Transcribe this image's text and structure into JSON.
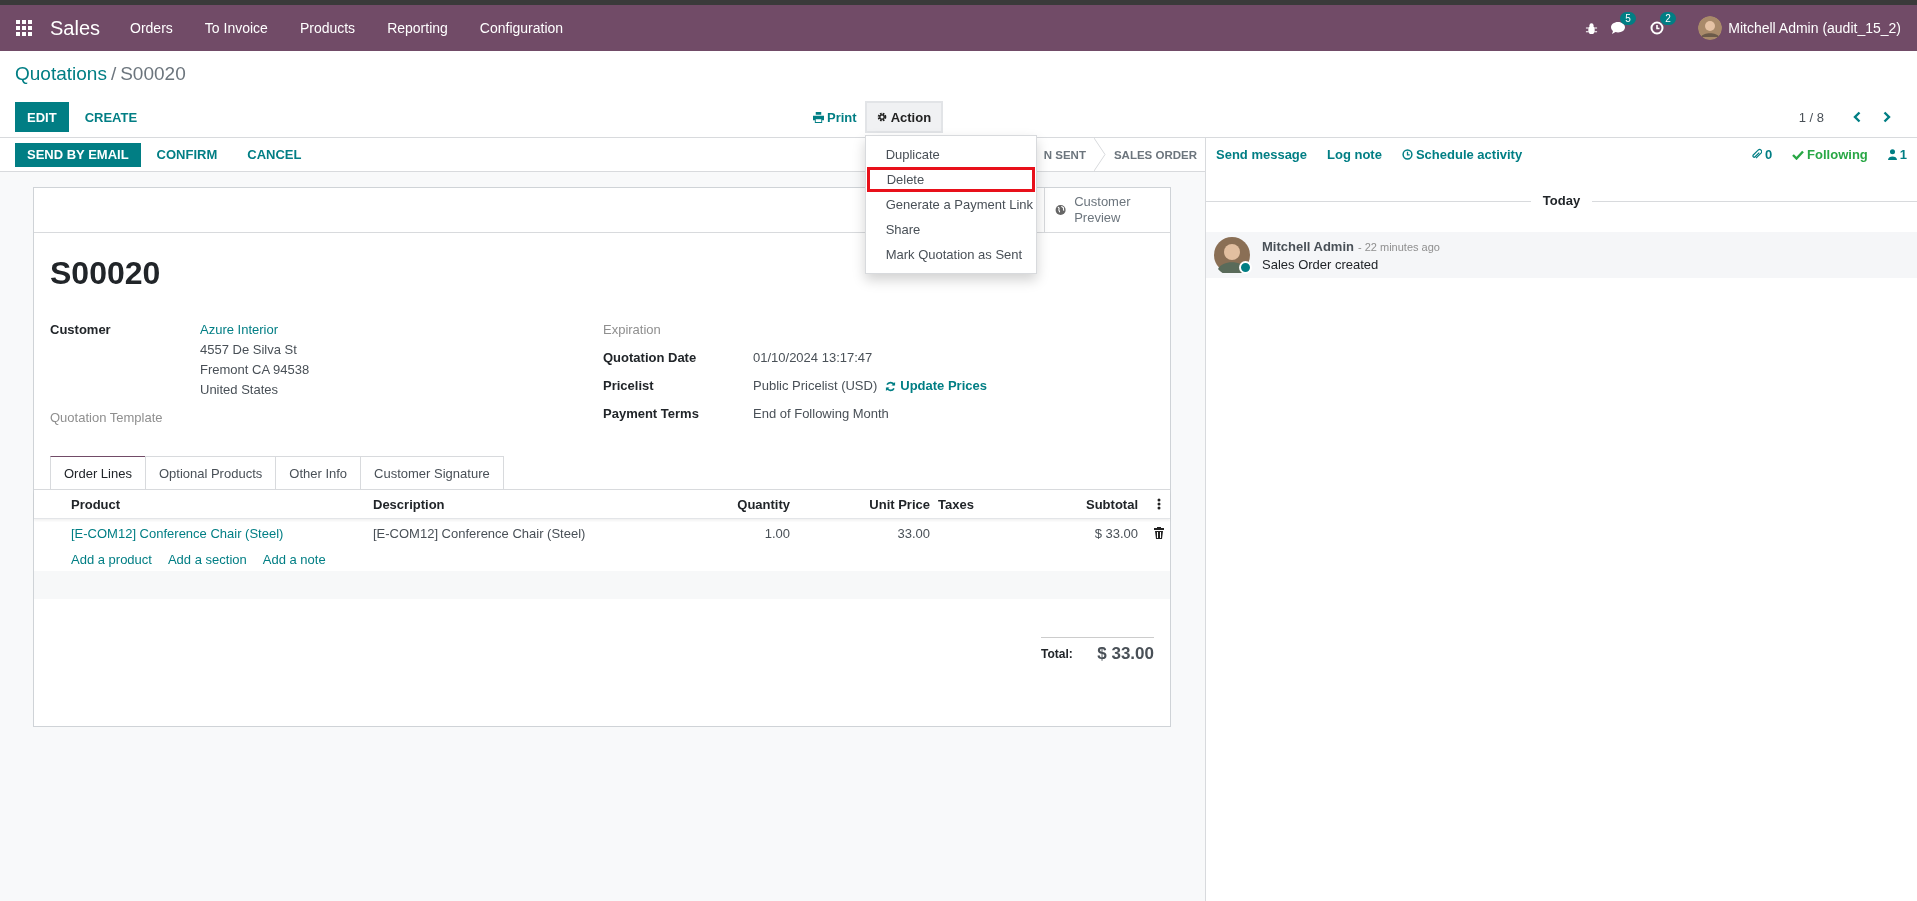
{
  "navbar": {
    "app": "Sales",
    "menu": [
      "Orders",
      "To Invoice",
      "Products",
      "Reporting",
      "Configuration"
    ],
    "messages_badge": "5",
    "activities_badge": "2",
    "user": "Mitchell Admin (audit_15_2)"
  },
  "breadcrumb": {
    "parent": "Quotations",
    "separator": "/",
    "current": "S00020"
  },
  "control_panel": {
    "buttons": [
      "EDIT",
      "CREATE"
    ],
    "print": "Print",
    "action": "Action",
    "pager": "1 / 8",
    "action_menu": [
      {
        "label": "Duplicate",
        "highlighted": false
      },
      {
        "label": "Delete",
        "highlighted": true
      },
      {
        "label": "Generate a Payment Link",
        "highlighted": false
      },
      {
        "label": "Share",
        "highlighted": false
      },
      {
        "label": "Mark Quotation as Sent",
        "highlighted": false
      }
    ]
  },
  "statusbar": {
    "buttons": [
      "SEND BY EMAIL",
      "CONFIRM",
      "CANCEL"
    ],
    "stages": [
      "N SENT",
      "SALES ORDER"
    ]
  },
  "sheet": {
    "smart_button": "Customer Preview",
    "name": "S00020",
    "left_fields": [
      {
        "kind": "partner",
        "label": "Customer",
        "value": "Azure Interior",
        "lines": [
          "4557 De Silva St",
          "Fremont CA 94538",
          "United States"
        ]
      },
      {
        "kind": "empty",
        "label": "Quotation Template"
      }
    ],
    "right_fields": [
      {
        "kind": "empty",
        "label": "Expiration"
      },
      {
        "kind": "text",
        "label": "Quotation Date",
        "value": "01/10/2024 13:17:47"
      },
      {
        "kind": "pricelist",
        "label": "Pricelist",
        "value": "Public Pricelist (USD)",
        "link": "Update Prices"
      },
      {
        "kind": "text",
        "label": "Payment Terms",
        "value": "End of Following Month"
      }
    ],
    "tabs": [
      {
        "label": "Order Lines",
        "selected": true
      },
      {
        "label": "Optional Products",
        "selected": false
      },
      {
        "label": "Other Info",
        "selected": false
      },
      {
        "label": "Customer Signature",
        "selected": false
      }
    ],
    "table": {
      "columns": [
        "Product",
        "Description",
        "Quantity",
        "Unit Price",
        "Taxes",
        "Subtotal"
      ],
      "rows": [
        {
          "cells": [
            "[E-COM12] Conference Chair (Steel)",
            "[E-COM12] Conference Chair (Steel)",
            "1.00",
            "33.00",
            "",
            "$ 33.00"
          ]
        }
      ],
      "add_links": [
        "Add a product",
        "Add a section",
        "Add a note"
      ]
    },
    "total": {
      "label": "Total:",
      "value": "$ 33.00"
    }
  },
  "chatter": {
    "actions": [
      "Send message",
      "Log note",
      "Schedule activity"
    ],
    "attachments": "0",
    "follow": "Following",
    "followers": "1",
    "date_separator": "Today",
    "messages": [
      {
        "author": "Mitchell Admin",
        "time": "- 22 minutes ago",
        "body": "Sales Order created"
      }
    ]
  }
}
